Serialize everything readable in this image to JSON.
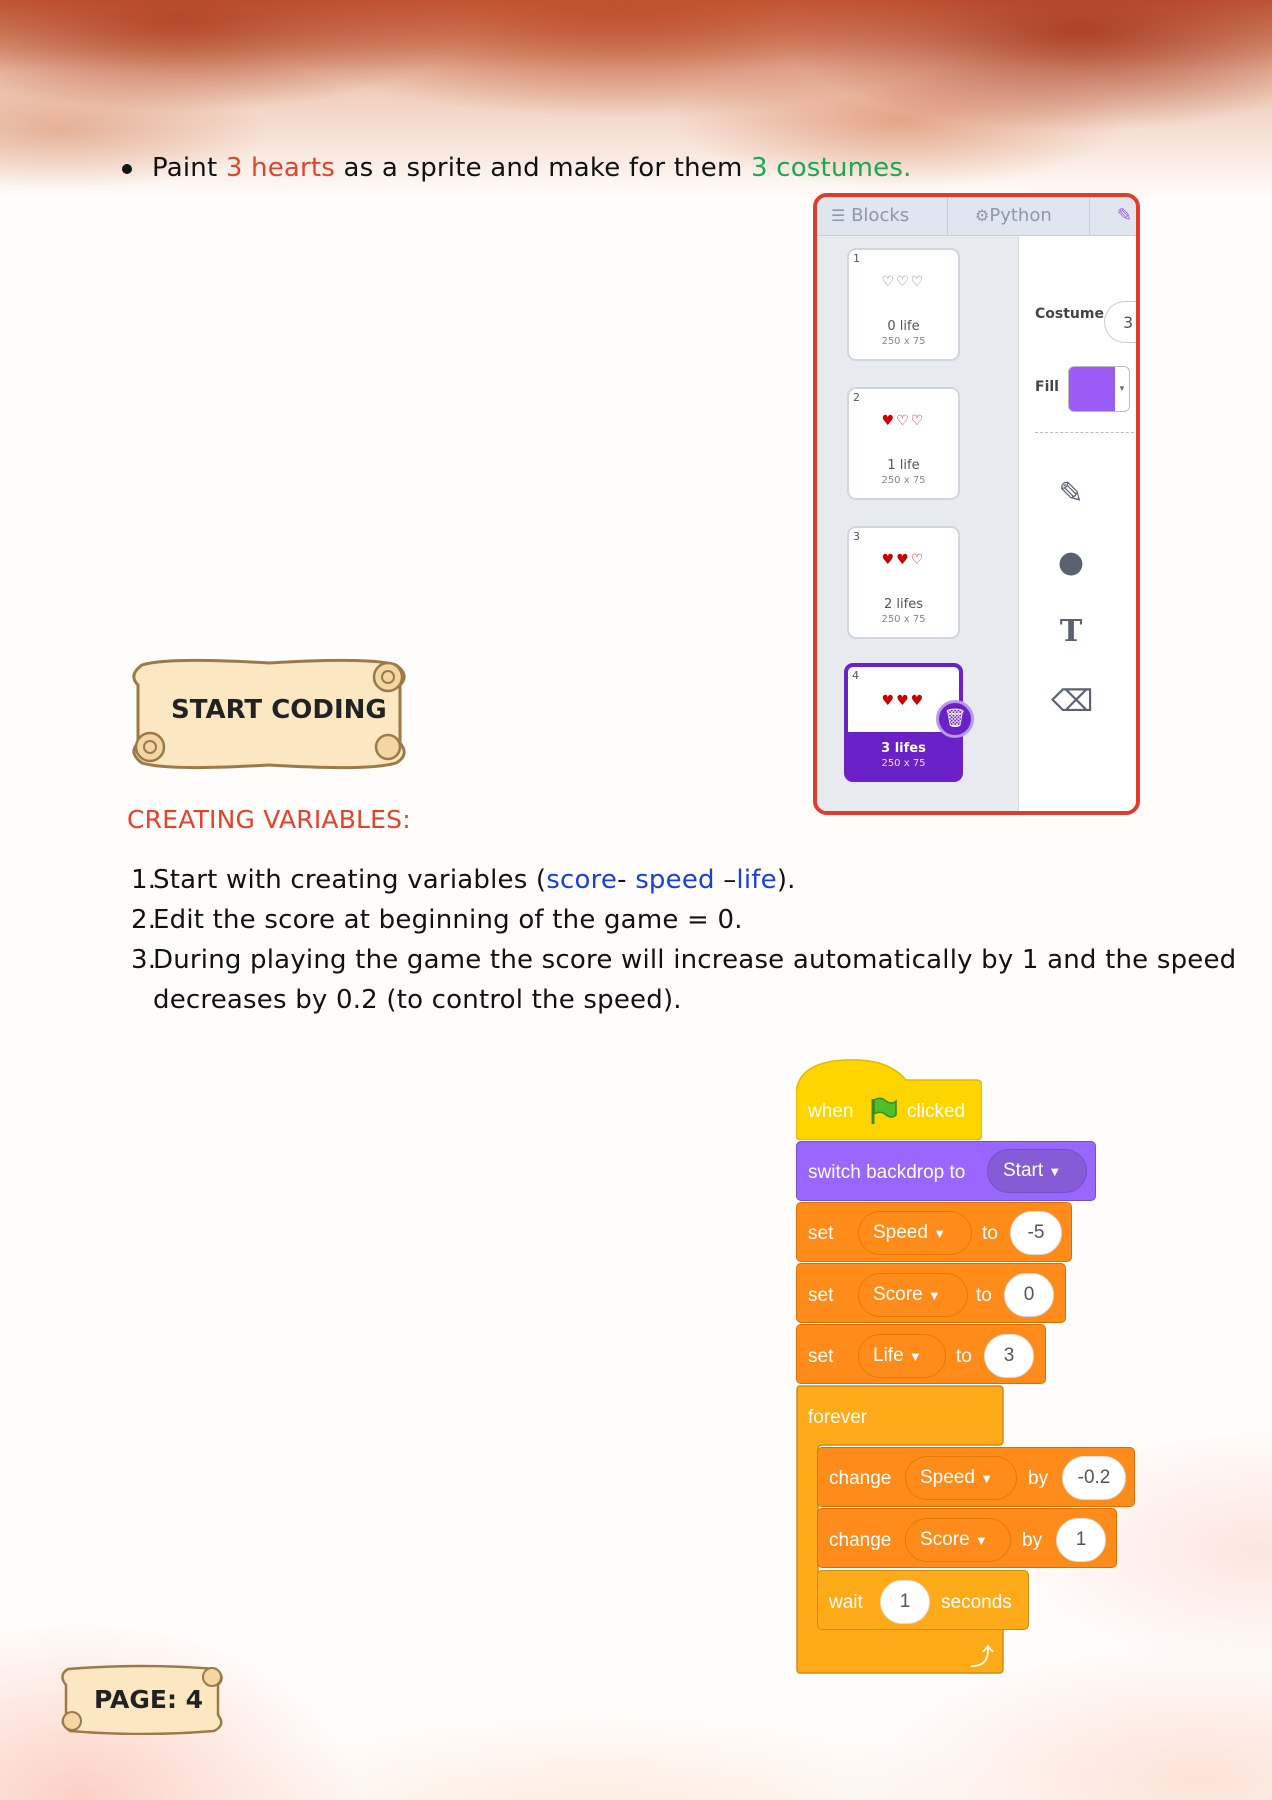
{
  "intro": {
    "p1": "Paint ",
    "p2": "3 hearts",
    "p3": " as a sprite and make for them ",
    "p4": "3 costumes."
  },
  "costume_panel": {
    "tabs": [
      "Blocks",
      "Python"
    ],
    "costumes": [
      {
        "num": "1",
        "hearts": "♡♡♡",
        "name": "0 life",
        "size": "250 x 75"
      },
      {
        "num": "2",
        "hearts": "♥♡♡",
        "name": "1 life",
        "size": "250 x 75"
      },
      {
        "num": "3",
        "hearts": "♥♥♡",
        "name": "2 lifes",
        "size": "250 x 75"
      },
      {
        "num": "4",
        "hearts": "♥♥♥",
        "name": "3 lifes",
        "size": "250 x 75"
      }
    ],
    "costume_label": "Costume",
    "costume_number": "3",
    "fill_label": "Fill",
    "fill_color": "#9a5cf5",
    "accent_color": "#6b21c8",
    "tools": [
      "brush-icon",
      "circle-icon",
      "text-icon",
      "eraser-icon"
    ],
    "tool_glyphs": [
      "✎",
      "●",
      "T",
      "⌫"
    ]
  },
  "start_coding": "START CODING",
  "section_heading": "CREATING VARIABLES:",
  "steps": {
    "s1_num": "1.",
    "s1_a": "Start with creating variables (",
    "s1_score": "score",
    "s1_b": "- ",
    "s1_speed": "speed",
    "s1_c": " –",
    "s1_life": "life",
    "s1_d": ").",
    "s2_num": "2.",
    "s2": "Edit the score at beginning of the game = 0.",
    "s3_num": "3.",
    "s3_line1": "During playing the game the score will increase automatically by 1 and the speed",
    "s3_line2": "decreases by 0.2 (to control the speed)."
  },
  "script": {
    "hat_when": "when",
    "hat_clicked": "clicked",
    "backdrop_label": "switch backdrop to",
    "backdrop_value": "Start",
    "set1": {
      "label": "set",
      "var": "Speed",
      "to": "to",
      "value": "-5"
    },
    "set2": {
      "label": "set",
      "var": "Score",
      "to": "to",
      "value": "0"
    },
    "set3": {
      "label": "set",
      "var": "Life",
      "to": "to",
      "value": "3"
    },
    "forever": "forever",
    "change1": {
      "label": "change",
      "var": "Speed",
      "by": "by",
      "value": "-0.2"
    },
    "change2": {
      "label": "change",
      "var": "Score",
      "by": "by",
      "value": "1"
    },
    "wait": {
      "label": "wait",
      "value": "1",
      "unit": "seconds"
    },
    "loop_arrow": "⤴",
    "colors": {
      "events": "#ffd500",
      "looks": "#9966ff",
      "variables": "#ff8c1a",
      "control": "#ffab19"
    }
  },
  "page_label": "PAGE: 4"
}
